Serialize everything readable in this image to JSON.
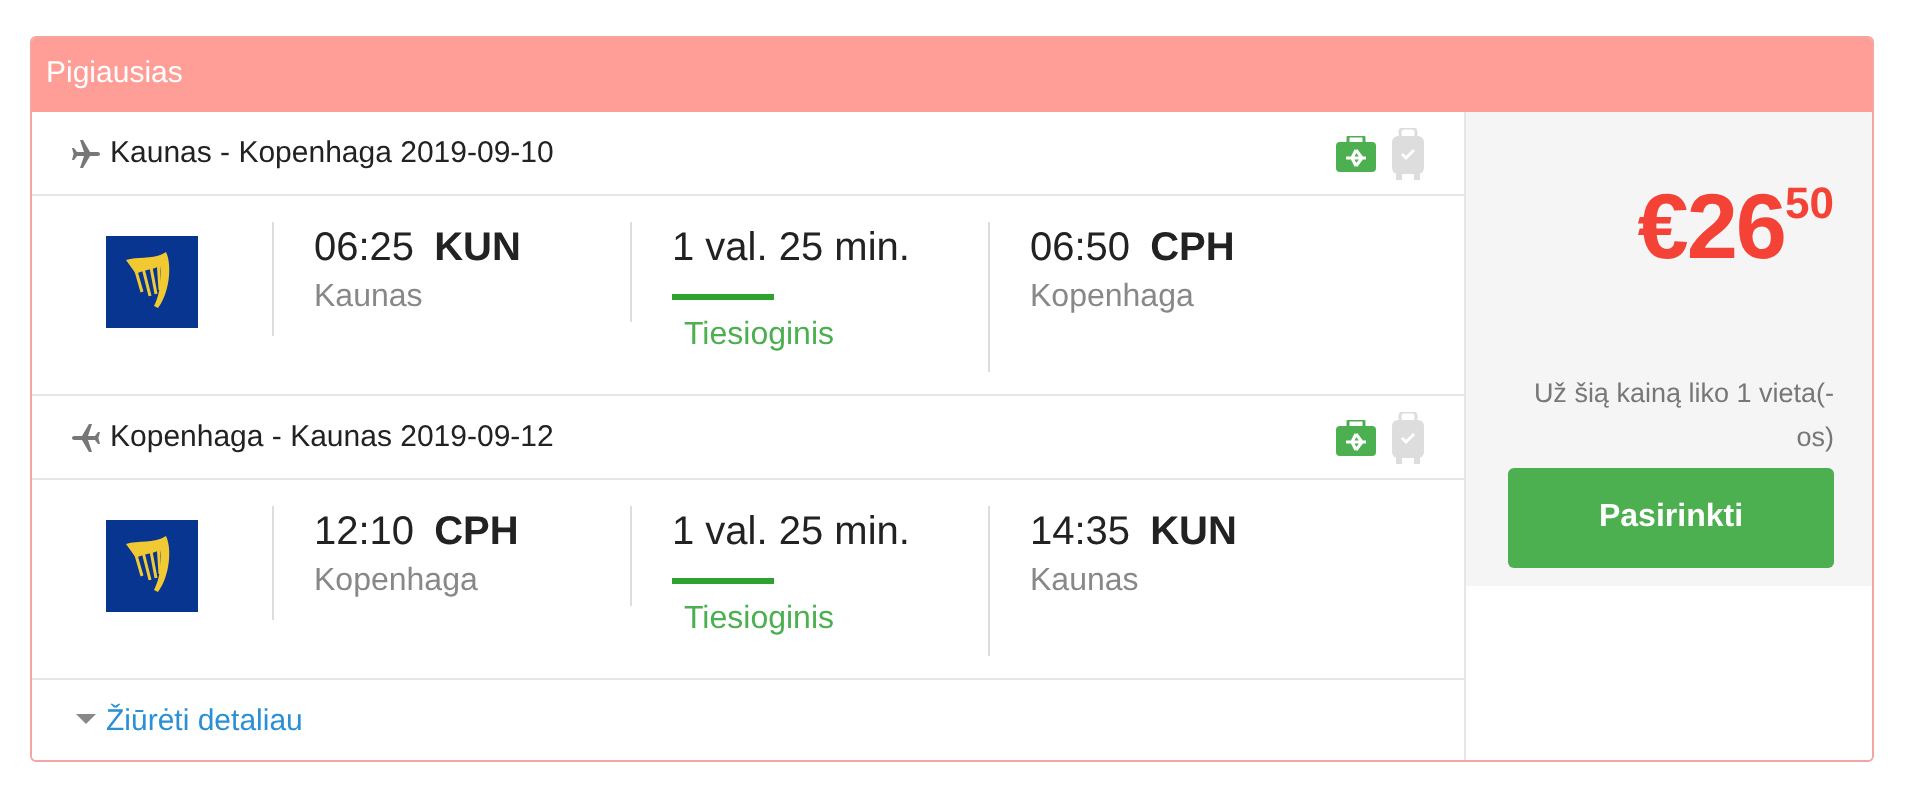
{
  "card": {
    "title": "Pigiausias"
  },
  "legs": [
    {
      "kind": "outbound",
      "route": "Kaunas - Kopenhaga 2019-09-10",
      "departure": {
        "time": "06:25",
        "code": "KUN",
        "city": "Kaunas"
      },
      "duration": "1 val. 25 min.",
      "stops": "Tiesioginis",
      "arrival": {
        "time": "06:50",
        "code": "CPH",
        "city": "Kopenhaga"
      }
    },
    {
      "kind": "return",
      "route": "Kopenhaga - Kaunas 2019-09-12",
      "departure": {
        "time": "12:10",
        "code": "CPH",
        "city": "Kopenhaga"
      },
      "duration": "1 val. 25 min.",
      "stops": "Tiesioginis",
      "arrival": {
        "time": "14:35",
        "code": "KUN",
        "city": "Kaunas"
      }
    }
  ],
  "details_link": "Žiūrėti detaliau",
  "price": {
    "main": "€26",
    "cents": "50",
    "note": "Už šią kainą liko 1 vieta(-os)",
    "button": "Pasirinkti"
  }
}
